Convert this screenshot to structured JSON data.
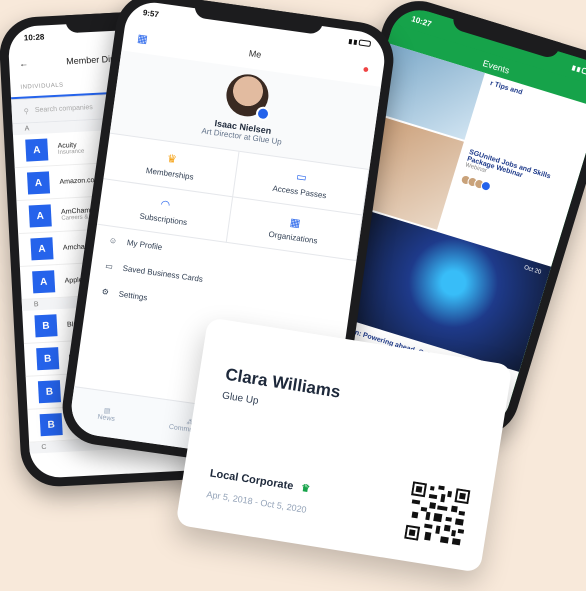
{
  "phone1": {
    "time": "10:28",
    "header_title": "Member Director",
    "tabs": [
      "INDIVIDUALS",
      ""
    ],
    "search_placeholder": "Search companies",
    "sections": [
      {
        "letter": "A",
        "members": [
          {
            "name": "Acuity",
            "sub": "Insurance"
          },
          {
            "name": "Amazon.com",
            "sub": ""
          },
          {
            "name": "AmCham Kenya Te",
            "sub": "Careers & Recruitment"
          },
          {
            "name": "Amcham Thailan",
            "sub": ""
          },
          {
            "name": "Apple",
            "sub": ""
          }
        ]
      },
      {
        "letter": "B",
        "members": [
          {
            "name": "BICUTAN G",
            "sub": ""
          },
          {
            "name": "Bruce Te",
            "sub": ""
          },
          {
            "name": "Bruce",
            "sub": ""
          },
          {
            "name": "BUR",
            "sub": ""
          }
        ]
      },
      {
        "letter": "C",
        "members": []
      }
    ]
  },
  "phone2": {
    "time": "9:57",
    "header_title": "Me",
    "name": "Isaac Nielsen",
    "role": "Art Director at Glue Up",
    "grid": [
      {
        "label": "Memberships",
        "icon": "crown-icon"
      },
      {
        "label": "Access Passes",
        "icon": "ticket-icon"
      },
      {
        "label": "Subscriptions",
        "icon": "rss-icon"
      },
      {
        "label": "Organizations",
        "icon": "org-icon"
      }
    ],
    "menu": [
      {
        "label": "My Profile",
        "icon": "person-icon"
      },
      {
        "label": "Saved Business Cards",
        "icon": "card-icon"
      },
      {
        "label": "Settings",
        "icon": "gear-icon"
      }
    ],
    "nav": [
      "News",
      "Communities"
    ]
  },
  "phone3": {
    "time": "10:27",
    "header_title": "Events",
    "events": [
      {
        "title": "r Tips and",
        "sub": ""
      },
      {
        "title": "SGUnited Jobs and Skills Package Webinar",
        "sub": "Webinar"
      },
      {
        "title": "CxO Luncheon: Powering ahead, October 20th",
        "sub": "Oct 20"
      }
    ],
    "date_badge": "Oct 20"
  },
  "card": {
    "name": "Clara Williams",
    "org": "Glue Up",
    "plan": "Local Corporate",
    "dates": "Apr 5, 2018 - Oct 5, 2020"
  }
}
